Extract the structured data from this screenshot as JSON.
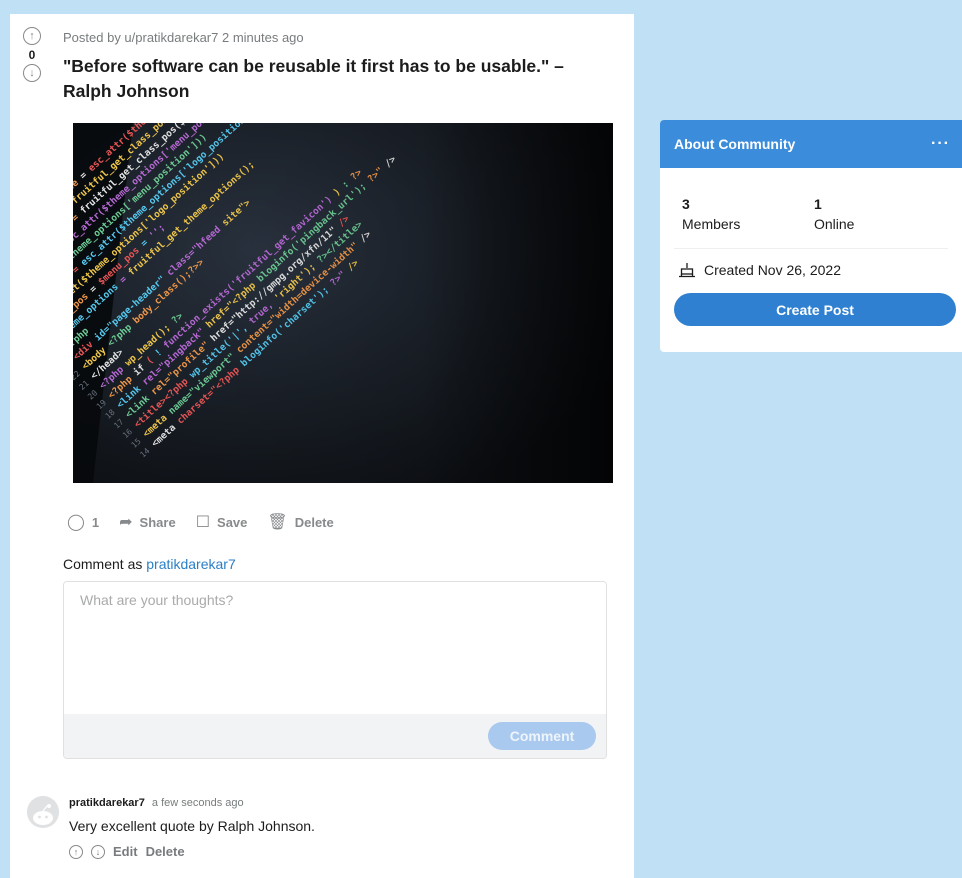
{
  "post": {
    "score": "0",
    "meta": "Posted by u/pratikdarekar7 2 minutes ago",
    "title": "\"Before software can be reusable it first has to be usable.\" – Ralph Johnson",
    "image_alt": "code editor screenshot",
    "code_lines": [
      "<meta charset=\"<?php bloginfo('charset'); ?>\" />",
      "<meta name=\"viewport\" content=\"width=device-width\" />",
      "<title><?php wp_title('|', true, 'right'); ?></title>",
      "<link rel=\"profile\" href=\"http://gmpg.org/xfn/11\" />",
      "<link rel=\"pingback\" href=\"<?php bloginfo('pingback_url'); ?>\" />",
      "<?php if ( ! function_exists('fruitful_get_favicon') ) : ?>",
      "<?php wp_head(); ?>",
      "</head>",
      "<body <?php body_class();?>>",
      "<div id=\"page-header\" class=\"hfeed site\">",
      "<?php",
      "$theme_options = fruitful_get_theme_options();",
      "$logo_pos = $menu_pos = '';",
      "if (isset($theme_options['logo_position']))",
      "$logo_pos = esc_attr($theme_options['logo_position']);",
      "if (isset($theme_options['menu_position']))",
      "$menu_pos = esc_attr($theme_options['menu_position']);",
      "$logo_pos_class = fruitful_get_class_pos($logo_pos);",
      "$menu_pos_class = fruitful_get_class_pos($menu_pos);",
      "$responsive_menu_type = esc_attr($theme_options['menu_type']);"
    ],
    "actions": {
      "comments_count": "1",
      "share": "Share",
      "save": "Save",
      "delete": "Delete"
    }
  },
  "comment_form": {
    "prefix": "Comment as",
    "username": "pratikdarekar7",
    "placeholder": "What are your thoughts?",
    "submit": "Comment"
  },
  "comments": [
    {
      "author": "pratikdarekar7",
      "time": "a few seconds ago",
      "text": "Very excellent quote by Ralph Johnson.",
      "edit": "Edit",
      "delete": "Delete"
    }
  ],
  "community": {
    "title": "About Community",
    "more": "···",
    "members_count": "3",
    "members_label": "Members",
    "online_count": "1",
    "online_label": "Online",
    "created": "Created Nov 26, 2022",
    "create_post": "Create Post"
  },
  "icons": {
    "upvote": "arrow-up-circle-icon",
    "downvote": "arrow-down-circle-icon",
    "comment": "speech-bubble-icon",
    "share": "share-arrow-icon",
    "save": "bookmark-icon",
    "delete": "trash-icon",
    "cake": "cake-icon",
    "avatar": "reddit-avatar-icon"
  },
  "colors": {
    "page_bg": "#bfe0f5",
    "brand_blue": "#3b8ddb",
    "button_blue": "#2f80d0",
    "link_blue": "#2a7fc7",
    "disabled_button": "#a9c9ee"
  }
}
